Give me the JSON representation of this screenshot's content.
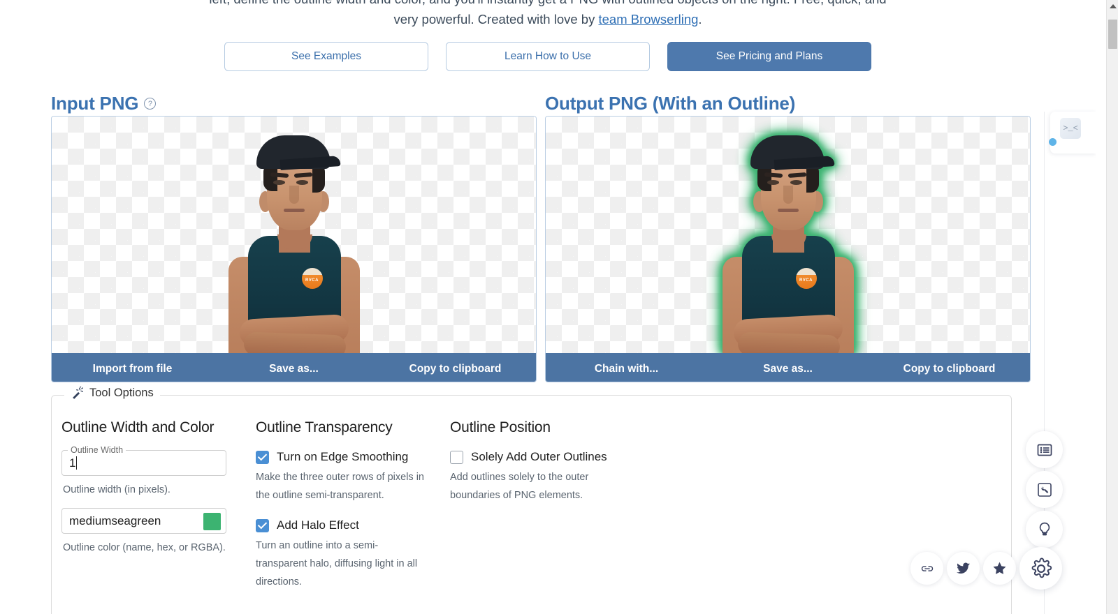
{
  "intro": {
    "line1": "left, define the outline width and color, and you'll instantly get a PNG with outlined objects on the right. Free, quick, and",
    "line2_pre": "very powerful. Created with love by ",
    "link": "team Browserling",
    "line2_post": "."
  },
  "buttons": {
    "see_examples": "See Examples",
    "learn_how": "Learn How to Use",
    "see_pricing": "See Pricing and Plans"
  },
  "input_pane": {
    "title": "Input PNG",
    "help_icon": "question-mark-circle-icon",
    "actions": [
      "Import from file",
      "Save as...",
      "Copy to clipboard"
    ],
    "patch_text": "RVCA"
  },
  "output_pane": {
    "title": "Output PNG (With an Outline)",
    "actions": [
      "Chain with...",
      "Save as...",
      "Copy to clipboard"
    ],
    "patch_text": "RVCA"
  },
  "tool_options": {
    "legend": "Tool Options",
    "legend_icon": "magic-wand-icon",
    "col_width_color": {
      "heading": "Outline Width and Color",
      "width_field_label": "Outline Width",
      "width_value": "1",
      "width_hint": "Outline width (in pixels).",
      "color_value": "mediumseagreen",
      "color_swatch_hex": "#3CB371",
      "color_hint": "Outline color (name, hex, or RGBA)."
    },
    "col_transparency": {
      "heading": "Outline Transparency",
      "options": [
        {
          "label": "Turn on Edge Smoothing",
          "checked": true,
          "hint": "Make the three outer rows of pixels in the outline semi-transparent."
        },
        {
          "label": "Add Halo Effect",
          "checked": true,
          "hint": "Turn an outline into a semi-transparent halo, diffusing light in all directions."
        }
      ]
    },
    "col_position": {
      "heading": "Outline Position",
      "options": [
        {
          "label": "Solely Add Outer Outlines",
          "checked": false,
          "hint": "Add outlines solely to the outer boundaries of PNG elements."
        }
      ]
    }
  },
  "rail": {
    "items": [
      {
        "icon": "list-icon",
        "name": "all-tools"
      },
      {
        "icon": "wrench-icon",
        "name": "tool-settings"
      },
      {
        "icon": "lightbulb-icon",
        "name": "suggest-idea"
      }
    ]
  },
  "bottom_icons": [
    {
      "icon": "link-icon",
      "name": "share-link"
    },
    {
      "icon": "twitter-icon",
      "name": "twitter"
    },
    {
      "icon": "star-icon",
      "name": "bookmark"
    },
    {
      "icon": "gear-icon",
      "name": "settings"
    }
  ],
  "mini_widget": {
    "face": ">_<"
  },
  "colors": {
    "accent_blue": "#4e79ad",
    "heading_blue": "#3b72b0",
    "actionbar_blue": "#4c74a3",
    "outline_green": "#3CB371",
    "checkbox_blue": "#4a8fd4"
  }
}
